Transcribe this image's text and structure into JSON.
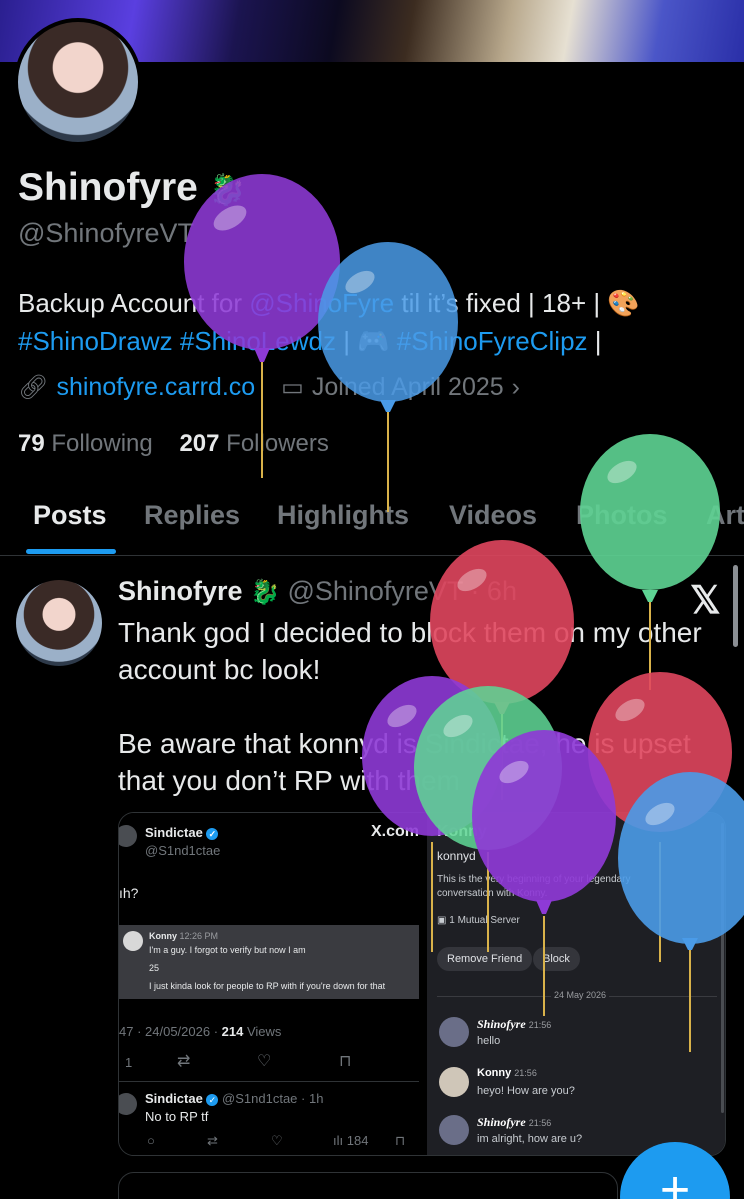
{
  "profile": {
    "name": "Shinofyre",
    "handle": "@ShinofyreVT",
    "bio_line1_prefix": "Backup Account for ",
    "bio_mention": "@ShinoFyre",
    "bio_line1_suffix": " til it’s fixed | 18+ | 🎨",
    "bio_tags1": "#ShinoDrawz #ShinoLewdz",
    "bio_sep": " | 🎮 ",
    "bio_tags2": "#ShinoFyreClipz",
    "bio_end": " |",
    "website": "shinofyre.carrd.co",
    "joined": "Joined April 2025",
    "following_count": "79",
    "following_label": "Following",
    "followers_count": "207",
    "followers_label": "Followers"
  },
  "tabs": [
    "Posts",
    "Replies",
    "Highlights",
    "Videos",
    "Photos",
    "Art"
  ],
  "post": {
    "name": "Shinofyre",
    "handle_time": "@ShinofyreVT · 6h",
    "text": "Thank god I decided to block them on my other account bc look!\n\nBe aware that konnyd is Sindictae, he is upset that you don’t RP with them"
  },
  "media": {
    "left": {
      "name": "Sindictae",
      "handle": "@S1nd1ctae",
      "snippet": "ıh?",
      "dm_name": "Konny",
      "dm_time": "12:26 PM",
      "dm_line1": "I'm a guy. I forgot to verify but now I am",
      "dm_line2": "25",
      "dm_line3": "I just kinda look for people to RP with if you're down for that",
      "date_prefix": "47 · 24/05/2026 · ",
      "views_count": "214",
      "views_label": "Views",
      "reply_count": "1",
      "x_watermark": "X.com",
      "reply_name": "Sindictae",
      "reply_handle": "@S1nd1ctae · 1h",
      "reply_text": "No to RP tf",
      "reply_views": "184"
    },
    "right": {
      "title": "Konny",
      "username": "konnyd",
      "intro": "This is the very beginning of your legendary conversation with Konny.",
      "mutual": "1 Mutual Server",
      "remove_friend": "Remove Friend",
      "block": "Block",
      "date": "24 May 2026",
      "messages": [
        {
          "author": "Shinofyre",
          "time": "21:56",
          "text": "hello"
        },
        {
          "author": "Konny",
          "time": "21:56",
          "text": "heyo! How are you?"
        },
        {
          "author": "Shinofyre",
          "time": "21:56",
          "text": "im alright, how are u?"
        }
      ]
    }
  },
  "fab": {
    "label": "+"
  },
  "colors": {
    "accent": "#1d9bf0",
    "background": "#000000",
    "muted": "#71767b"
  },
  "balloon_colors": [
    "#8e3ad6",
    "#4a9be8",
    "#5ed494",
    "#e0465e"
  ]
}
